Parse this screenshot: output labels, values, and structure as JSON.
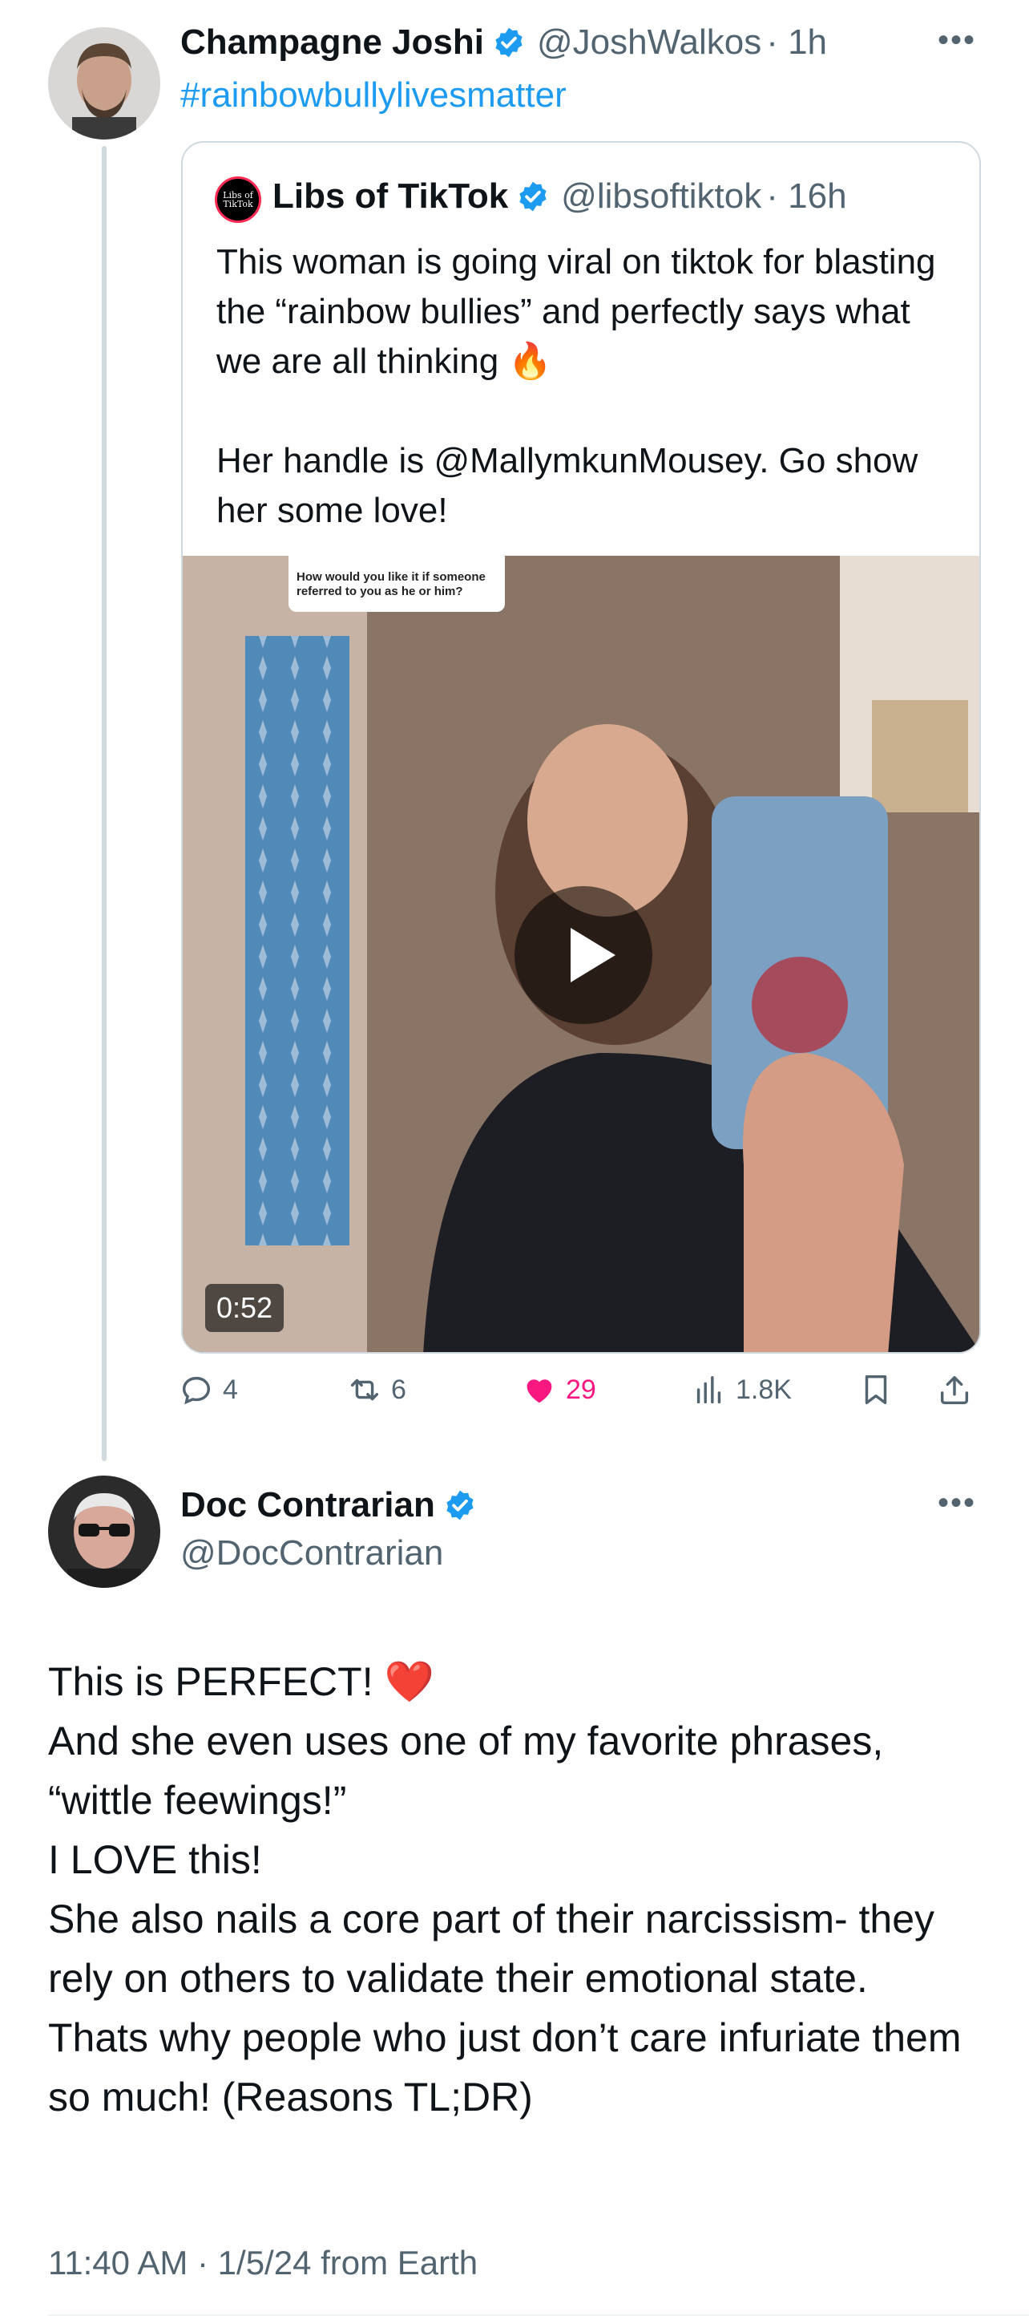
{
  "reply_tweet": {
    "author_name": "Champagne Joshi",
    "author_handle": "@JoshWalkos",
    "time": "· 1h",
    "text": "#rainbowbullylivesmatter",
    "more_icon": "more-horizontal-icon"
  },
  "quoted_tweet": {
    "author_name": "Libs of TikTok",
    "avatar_text": "Libs of TikTok",
    "author_handle": "@libsoftiktok",
    "time": "· 16h",
    "text": "This woman is going viral on tiktok for blasting the “rainbow bullies” and perfectly says what we are all thinking 🔥\n\nHer handle is @MallymkunMousey. Go show her some love!",
    "video": {
      "overlay_caption": "How would you like it if someone referred to you as he or him?",
      "duration": "0:52"
    }
  },
  "actions": {
    "replies": "4",
    "reposts": "6",
    "likes": "29",
    "views": "1.8K",
    "like_color": "#f91880"
  },
  "main_tweet": {
    "author_name": "Doc Contrarian",
    "author_handle": "@DocContrarian",
    "text": "This is PERFECT! ❤️\nAnd she even uses one of my favorite phrases, “wittle feewings!”\nI LOVE this!\nShe also nails a core part of their narcissism- they rely on others to validate their emotional state.\nThats why people who just don’t care infuriate them so much! (Reasons TL;DR)",
    "timestamp": "11:40 AM · 1/5/24 from Earth"
  },
  "colors": {
    "verified_blue": "#1d9bf0",
    "secondary_text": "#536471"
  }
}
